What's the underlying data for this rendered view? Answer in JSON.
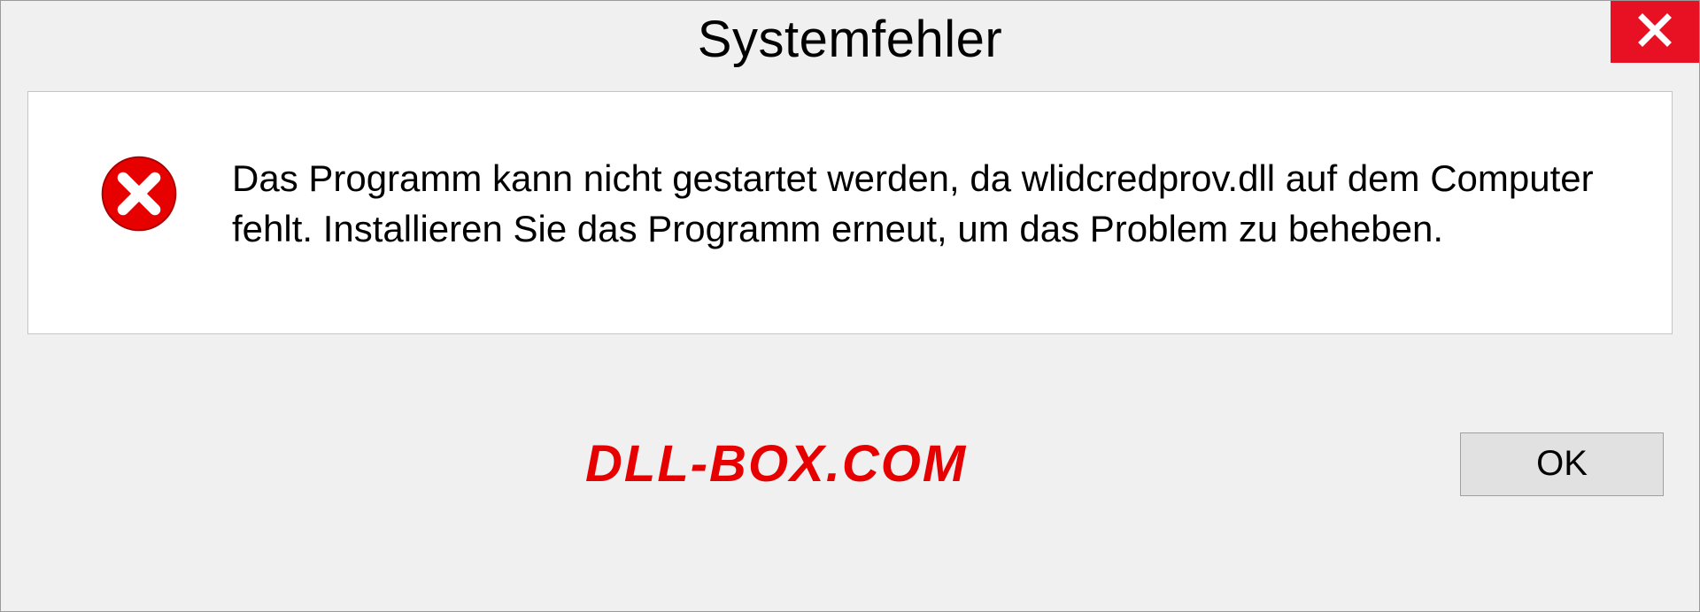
{
  "titlebar": {
    "title": "Systemfehler"
  },
  "body": {
    "message": "Das Programm kann nicht gestartet werden, da wlidcredprov.dll auf dem Computer fehlt. Installieren Sie das Programm erneut, um das Problem zu beheben."
  },
  "footer": {
    "watermark": "DLL-BOX.COM",
    "ok_label": "OK"
  },
  "icons": {
    "close": "close-icon",
    "error": "error-icon"
  },
  "colors": {
    "close_bg": "#e81123",
    "accent_red": "#e60000",
    "panel_bg": "#ffffff",
    "dialog_bg": "#f0f0f0"
  }
}
